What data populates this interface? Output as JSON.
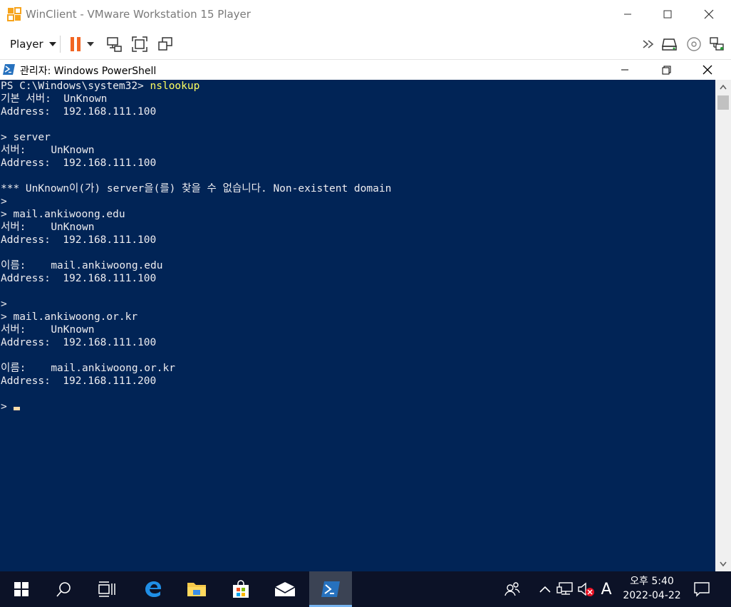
{
  "vm": {
    "title": "WinClient - VMware Workstation 15 Player",
    "player_menu_label": "Player"
  },
  "powershell": {
    "title": "관리자: Windows PowerShell",
    "prompt": "PS C:\\Windows\\system32> ",
    "command": "nslookup",
    "output_lines": [
      "기본 서버:  UnKnown",
      "Address:  192.168.111.100",
      "",
      "> server",
      "서버:    UnKnown",
      "Address:  192.168.111.100",
      "",
      "*** UnKnown이(가) server을(를) 찾을 수 없습니다. Non-existent domain",
      ">",
      "> mail.ankiwoong.edu",
      "서버:    UnKnown",
      "Address:  192.168.111.100",
      "",
      "이름:    mail.ankiwoong.edu",
      "Address:  192.168.111.100",
      "",
      ">",
      "> mail.ankiwoong.or.kr",
      "서버:    UnKnown",
      "Address:  192.168.111.100",
      "",
      "이름:    mail.ankiwoong.or.kr",
      "Address:  192.168.111.200",
      ""
    ],
    "current_prompt": "> "
  },
  "taskbar": {
    "ime_indicator": "A",
    "clock_time": "오후 5:40",
    "clock_date": "2022-04-22"
  },
  "colors": {
    "console_bg": "#012456",
    "console_fg": "#eeedf0",
    "command_fg": "#ffff60",
    "taskbar_bg": "#0c1227"
  }
}
